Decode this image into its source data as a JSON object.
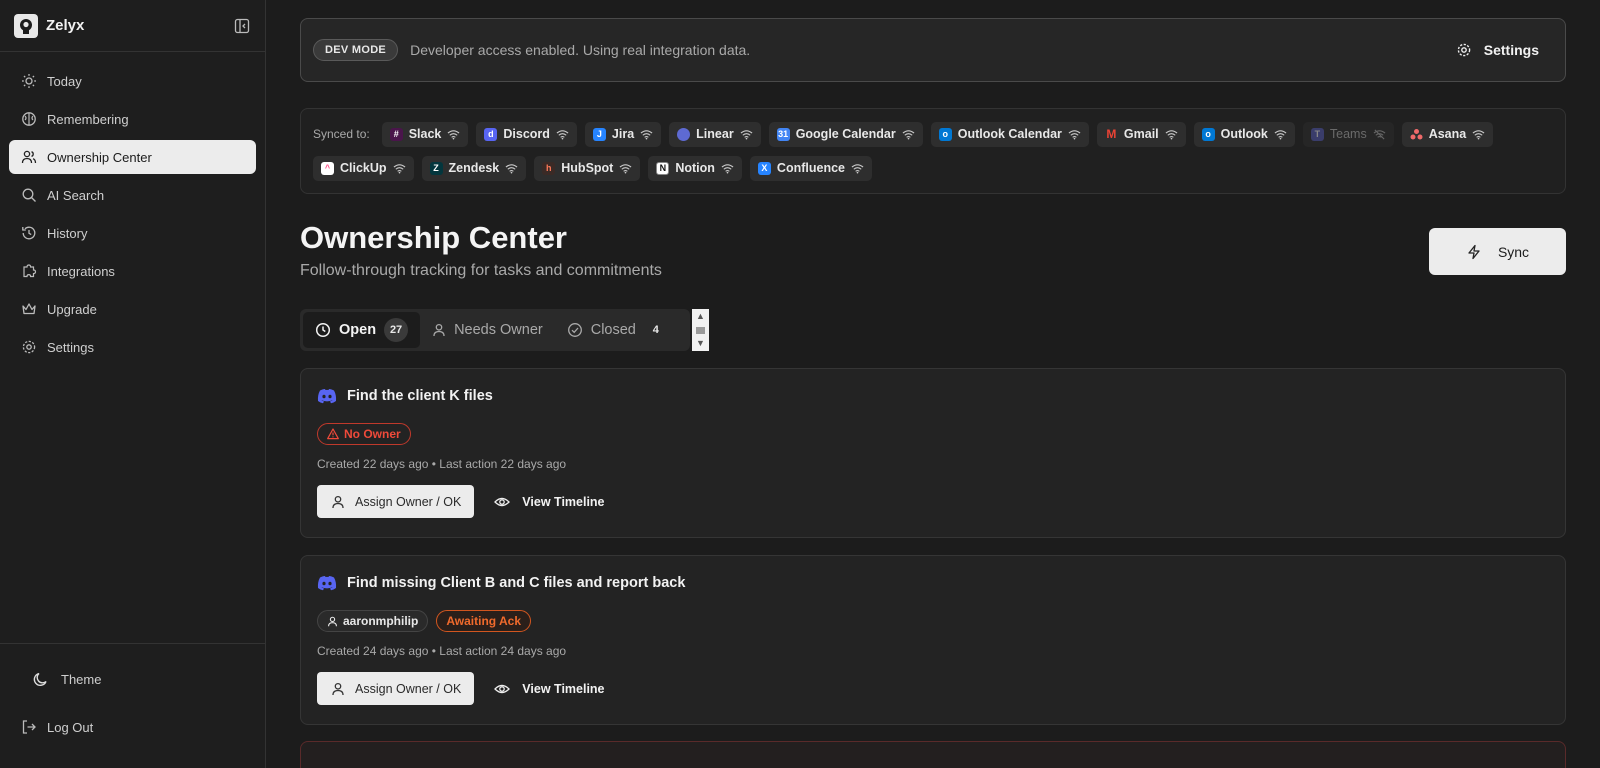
{
  "app": {
    "name": "Zelyx"
  },
  "sidebar": {
    "items": [
      {
        "label": "Today",
        "icon": "sun-icon"
      },
      {
        "label": "Remembering",
        "icon": "brain-icon"
      },
      {
        "label": "Ownership Center",
        "icon": "users-icon",
        "active": true
      },
      {
        "label": "AI Search",
        "icon": "search-icon"
      },
      {
        "label": "History",
        "icon": "history-icon"
      },
      {
        "label": "Integrations",
        "icon": "puzzle-icon"
      },
      {
        "label": "Upgrade",
        "icon": "crown-icon"
      },
      {
        "label": "Settings",
        "icon": "gear-icon"
      }
    ],
    "theme_label": "Theme",
    "logout_label": "Log Out"
  },
  "devbar": {
    "badge": "DEV MODE",
    "text": "Developer access enabled. Using real integration data.",
    "settings_label": "Settings"
  },
  "sync": {
    "label": "Synced to:",
    "integrations": [
      {
        "name": "Slack",
        "color": "#e01e5a",
        "connected": true
      },
      {
        "name": "Discord",
        "color": "#5865f2",
        "connected": true
      },
      {
        "name": "Jira",
        "color": "#2684ff",
        "connected": true
      },
      {
        "name": "Linear",
        "color": "#5e6ad2",
        "connected": true
      },
      {
        "name": "Google Calendar",
        "color": "#4285f4",
        "connected": true
      },
      {
        "name": "Outlook Calendar",
        "color": "#0078d4",
        "connected": true
      },
      {
        "name": "Gmail",
        "color": "#ea4335",
        "connected": true
      },
      {
        "name": "Outlook",
        "color": "#0078d4",
        "connected": true
      },
      {
        "name": "Teams",
        "color": "#5059c9",
        "connected": false
      },
      {
        "name": "Asana",
        "color": "#f06a6a",
        "connected": true
      },
      {
        "name": "ClickUp",
        "color": "#ff4f88",
        "connected": true
      },
      {
        "name": "Zendesk",
        "color": "#03363d",
        "connected": true
      },
      {
        "name": "HubSpot",
        "color": "#ff7a59",
        "connected": true
      },
      {
        "name": "Notion",
        "color": "#ffffff",
        "connected": true
      },
      {
        "name": "Confluence",
        "color": "#2684ff",
        "connected": true
      }
    ]
  },
  "page": {
    "title": "Ownership Center",
    "subtitle": "Follow-through tracking for tasks and commitments",
    "sync_button": "Sync"
  },
  "tabs": [
    {
      "label": "Open",
      "count": "27",
      "active": true
    },
    {
      "label": "Needs Owner",
      "count": ""
    },
    {
      "label": "Closed",
      "count": "4"
    }
  ],
  "cards": [
    {
      "title": "Find the client K files",
      "source": "discord",
      "owner": "",
      "status": "No Owner",
      "meta_created": "Created 22 days ago",
      "meta_last": "• Last action 22 days ago",
      "assign_label": "Assign Owner / OK",
      "timeline_label": "View Timeline"
    },
    {
      "title": "Find missing Client B and C files and report back",
      "source": "discord",
      "owner": "aaronmphilip",
      "status": "Awaiting Ack",
      "meta_created": "Created 24 days ago",
      "meta_last": "• Last action 24 days ago",
      "assign_label": "Assign Owner / OK",
      "timeline_label": "View Timeline"
    }
  ],
  "colors": {
    "background": "#1c1c1c",
    "accent_light": "#ececec",
    "status_no_owner": "#ef4a3a",
    "status_awaiting": "#f06a2c",
    "discord": "#5865f2"
  }
}
